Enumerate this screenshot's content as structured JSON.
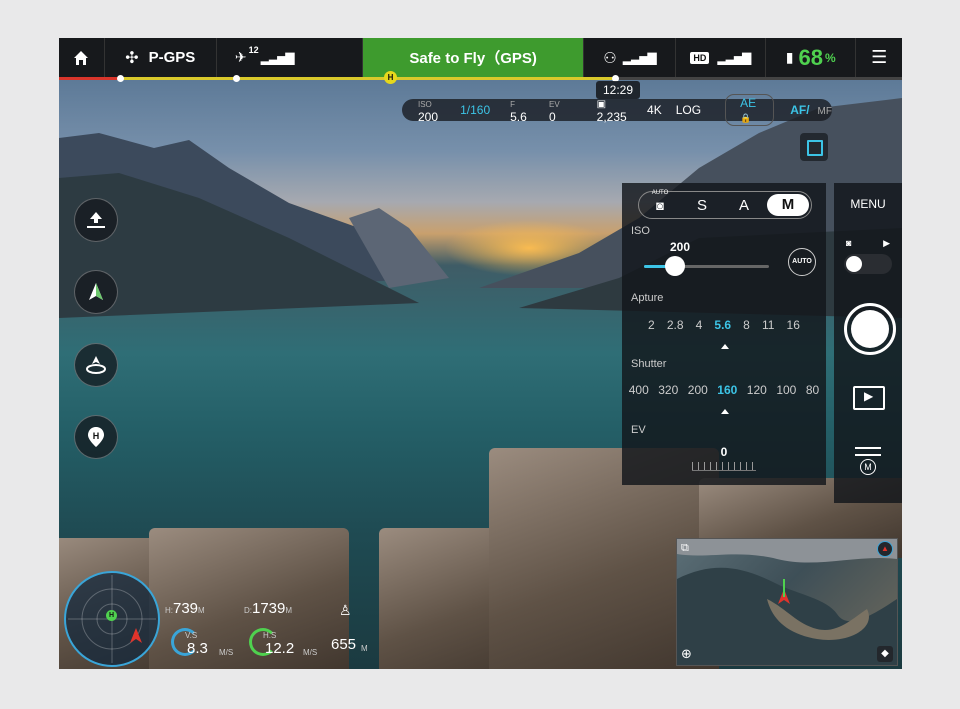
{
  "topbar": {
    "home_icon": "home-icon",
    "flight_mode": "P-GPS",
    "gps_count": "12",
    "status": "Safe to Fly（GPS)",
    "hd_label": "HD",
    "battery_percent": "68",
    "battery_unit": "%",
    "menu_icon": "list-icon"
  },
  "time": "12:29",
  "camera_bar": {
    "iso_label": "ISO",
    "iso_value": "200",
    "shutter_value": "1/160",
    "f_label": "F",
    "f_value": "5.6",
    "ev_label": "EV",
    "ev_value": "0",
    "capacity": "2,235",
    "resolution": "4K",
    "color_profile": "LOG",
    "ae_label": "AE",
    "af_label": "AF/",
    "mf_label": "MF"
  },
  "panel": {
    "mode_auto": "AUTO",
    "modes": [
      "S",
      "A",
      "M"
    ],
    "selected_mode": "M",
    "iso_label": "ISO",
    "iso_value": "200",
    "iso_auto_button": "AUTO",
    "iso_slider_level": 0.25,
    "aperture_label": "Apture",
    "aperture_values": [
      "2",
      "2.8",
      "4",
      "5.6",
      "8",
      "11",
      "16"
    ],
    "aperture_selected": "5.6",
    "shutter_label": "Shutter",
    "shutter_values": [
      "400",
      "320",
      "200",
      "160",
      "120",
      "100",
      "80"
    ],
    "shutter_selected": "160",
    "ev_label": "EV",
    "ev_value": "0"
  },
  "right": {
    "menu_label": "MENU",
    "m_badge": "M"
  },
  "telemetry": {
    "h_label": "H:",
    "height": "739",
    "height_unit": "M",
    "d_label": "D:",
    "distance": "1739",
    "distance_unit": "M",
    "vs_label": "V.S",
    "vertical_speed": "8.3",
    "speed_unit": "M/S",
    "hs_label": "H.S",
    "horizontal_speed": "12.2",
    "altitude_value": "655",
    "altitude_unit": "M",
    "radar_h": "H"
  },
  "colors": {
    "safe_green": "#3e9b2e",
    "accent_cyan": "#3cc4e6",
    "battery_green": "#4fd14f",
    "warning_yellow": "#e6d81c",
    "progress_red": "#d9352b"
  }
}
